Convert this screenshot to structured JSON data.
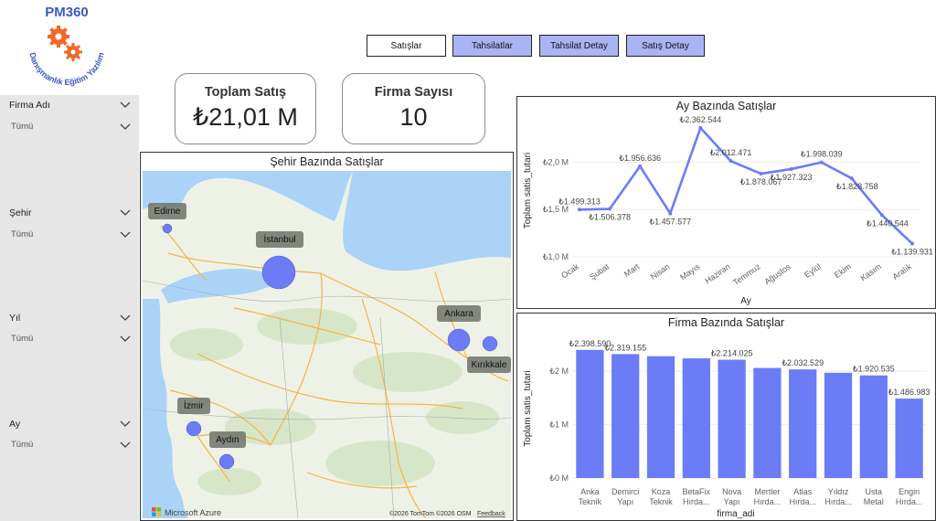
{
  "logo": {
    "text_top": "PM360",
    "text_ring": "Danışmanlık Eğitim Yazılım"
  },
  "nav": {
    "buttons": [
      {
        "label": "Satışlar",
        "active": false
      },
      {
        "label": "Tahsilatlar",
        "active": true
      },
      {
        "label": "Tahsilat Detay",
        "active": true
      },
      {
        "label": "Satış Detay",
        "active": true
      }
    ]
  },
  "filters": [
    {
      "label": "Firma Adı",
      "value": "Tümü"
    },
    {
      "label": "Şehir",
      "value": "Tümü"
    },
    {
      "label": "Yıl",
      "value": "Tümü"
    },
    {
      "label": "Ay",
      "value": "Tümü"
    }
  ],
  "kpis": {
    "total_sales": {
      "label": "Toplam Satış",
      "value": "₺21,01 M"
    },
    "firm_count": {
      "label": "Firma Sayısı",
      "value": "10"
    }
  },
  "map": {
    "title": "Şehir Bazında Satışlar",
    "footer_brand": "Microsoft Azure",
    "attribution": "©2026 TomTom  ©2026 OSM",
    "feedback": "Feedback",
    "cities": [
      {
        "name": "Edirne"
      },
      {
        "name": "İstanbul"
      },
      {
        "name": "Ankara"
      },
      {
        "name": "Kırıkkale"
      },
      {
        "name": "İzmir"
      },
      {
        "name": "Aydın"
      }
    ]
  },
  "colors": {
    "accent": "#6b7cf6",
    "nav_active": "#a9b4f4",
    "sidebar": "#e6e6e6",
    "sea": "#aad3f7",
    "land": "#eef2e6"
  },
  "chart_data": [
    {
      "type": "line",
      "title": "Ay Bazında Satışlar",
      "xlabel": "Ay",
      "ylabel": "Toplam satis_tutari",
      "ylim": [
        1.0,
        2.4
      ],
      "yticks": [
        "₺1,0 M",
        "₺1,5 M",
        "₺2,0 M"
      ],
      "categories": [
        "Ocak",
        "Şubat",
        "Mart",
        "Nisan",
        "Mayıs",
        "Haziran",
        "Temmuz",
        "Ağustos",
        "Eylül",
        "Ekim",
        "Kasım",
        "Aralık"
      ],
      "values": [
        1.499313,
        1.506378,
        1.956636,
        1.457577,
        2.362544,
        2.012471,
        1.878067,
        1.927323,
        1.998039,
        1.828758,
        1.440544,
        1.139931
      ],
      "labels": [
        "₺1.499.313",
        "₺1.506.378",
        "₺1.956.636",
        "₺1.457.577",
        "₺2.362.544",
        "₺2.012.471",
        "₺1.878.067",
        "₺1.927.323",
        "₺1.998.039",
        "₺1.828.758",
        "₺1.440.544",
        "₺1.139.931"
      ]
    },
    {
      "type": "bar",
      "title": "Firma Bazında Satışlar",
      "xlabel": "firma_adi",
      "ylabel": "Toplam satis_tutari",
      "ylim": [
        0,
        2.6
      ],
      "yticks": [
        "₺0 M",
        "₺1 M",
        "₺2 M"
      ],
      "categories": [
        [
          "Anka",
          "Teknik"
        ],
        [
          "Demirci",
          "Yapı"
        ],
        [
          "Koza",
          "Teknik"
        ],
        [
          "BetaFix",
          "Hırda..."
        ],
        [
          "Nova",
          "Yapı"
        ],
        [
          "Mertler",
          "Hırda..."
        ],
        [
          "Atlas",
          "Hırda..."
        ],
        [
          "Yıldız",
          "Hırda..."
        ],
        [
          "Usta",
          "Metal"
        ],
        [
          "Engin",
          "Hırda..."
        ]
      ],
      "values": [
        2.39859,
        2.319155,
        2.28,
        2.24,
        2.214025,
        2.06,
        2.032529,
        1.97,
        1.920535,
        1.486983
      ],
      "labels": [
        "₺2.398.590",
        "₺2.319.155",
        "",
        "",
        "₺2.214.025",
        "",
        "₺2.032.529",
        "",
        "₺1.920.535",
        "₺1.486.983"
      ]
    }
  ]
}
